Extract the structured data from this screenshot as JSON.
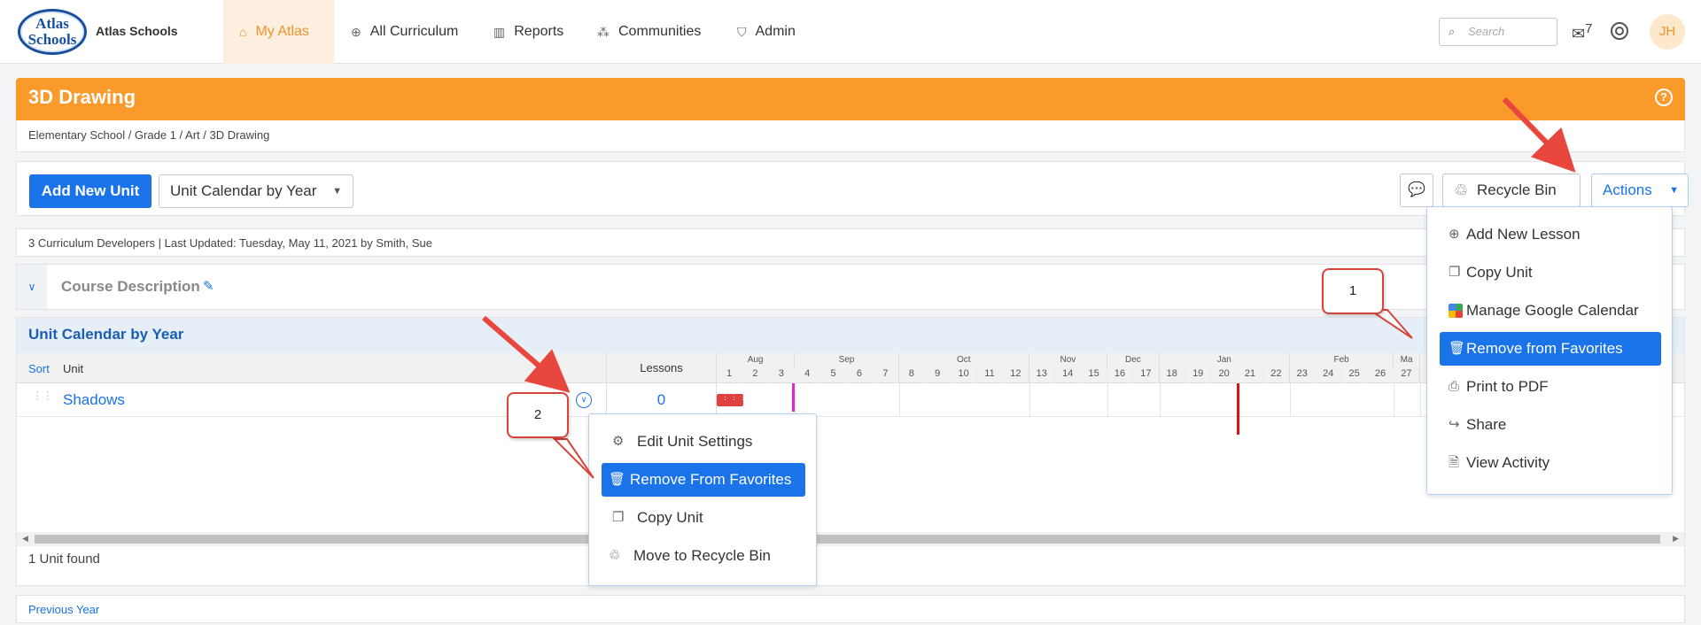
{
  "brand": {
    "logo_top": "Atlas",
    "logo_bottom": "Schools",
    "name": "Atlas Schools"
  },
  "nav": {
    "items": [
      {
        "label": "My Atlas",
        "icon": "home-icon"
      },
      {
        "label": "All Curriculum",
        "icon": "globe-icon"
      },
      {
        "label": "Reports",
        "icon": "bar-chart-icon"
      },
      {
        "label": "Communities",
        "icon": "network-icon"
      },
      {
        "label": "Admin",
        "icon": "shield-icon"
      }
    ],
    "search_placeholder": "Search",
    "mail_count": "7",
    "avatar_initials": "JH"
  },
  "page": {
    "title": "3D Drawing",
    "help": "?",
    "breadcrumb": "Elementary School  /  Grade 1  /  Art  /  3D Drawing"
  },
  "toolbar": {
    "add_unit": "Add New Unit",
    "view_select": "Unit Calendar by Year",
    "recycle_bin": "Recycle Bin",
    "actions": "Actions"
  },
  "meta": "3 Curriculum Developers | Last Updated: Tuesday, May 11, 2021 by Smith, Sue",
  "course_description": "Course Description",
  "calendar": {
    "title": "Unit Calendar by Year",
    "sort": "Sort",
    "unit_col": "Unit",
    "lessons_col": "Lessons",
    "months": [
      {
        "name": "Aug",
        "weeks": [
          "1",
          "2",
          "3"
        ]
      },
      {
        "name": "Sep",
        "weeks": [
          "4",
          "5",
          "6",
          "7"
        ]
      },
      {
        "name": "Oct",
        "weeks": [
          "8",
          "9",
          "10",
          "11",
          "12"
        ]
      },
      {
        "name": "Nov",
        "weeks": [
          "13",
          "14",
          "15"
        ]
      },
      {
        "name": "Dec",
        "weeks": [
          "16",
          "17"
        ]
      },
      {
        "name": "Jan",
        "weeks": [
          "18",
          "19",
          "20",
          "21",
          "22"
        ]
      },
      {
        "name": "Feb",
        "weeks": [
          "23",
          "24",
          "25",
          "26"
        ]
      },
      {
        "name": "Ma",
        "weeks": [
          "27"
        ]
      }
    ],
    "units": [
      {
        "name": "Shadows",
        "lessons": "0"
      }
    ],
    "found": "1 Unit found"
  },
  "footer": {
    "previous_year": "Previous Year"
  },
  "actions_menu": {
    "items": [
      {
        "label": "Add New Lesson",
        "icon": "plus-circle-icon"
      },
      {
        "label": "Copy Unit",
        "icon": "copy-icon"
      },
      {
        "label": "Manage Google Calendar",
        "icon": "google-calendar-icon"
      },
      {
        "label": "Remove from Favorites",
        "icon": "trash-icon",
        "selected": true
      },
      {
        "label": "Print to PDF",
        "icon": "print-icon"
      },
      {
        "label": "Share",
        "icon": "share-icon"
      },
      {
        "label": "View Activity",
        "icon": "activity-icon"
      }
    ]
  },
  "unit_menu": {
    "items": [
      {
        "label": "Edit Unit Settings",
        "icon": "gear-icon"
      },
      {
        "label": "Remove From Favorites",
        "icon": "trash-icon",
        "selected": true
      },
      {
        "label": "Copy Unit",
        "icon": "copy-icon"
      },
      {
        "label": "Move to Recycle Bin",
        "icon": "recycle-icon"
      }
    ]
  },
  "callouts": {
    "one": "1",
    "two": "2"
  },
  "colors": {
    "accent": "#1a73e8",
    "brand_orange": "#f99a2a",
    "annotation_red": "#e8473d"
  }
}
